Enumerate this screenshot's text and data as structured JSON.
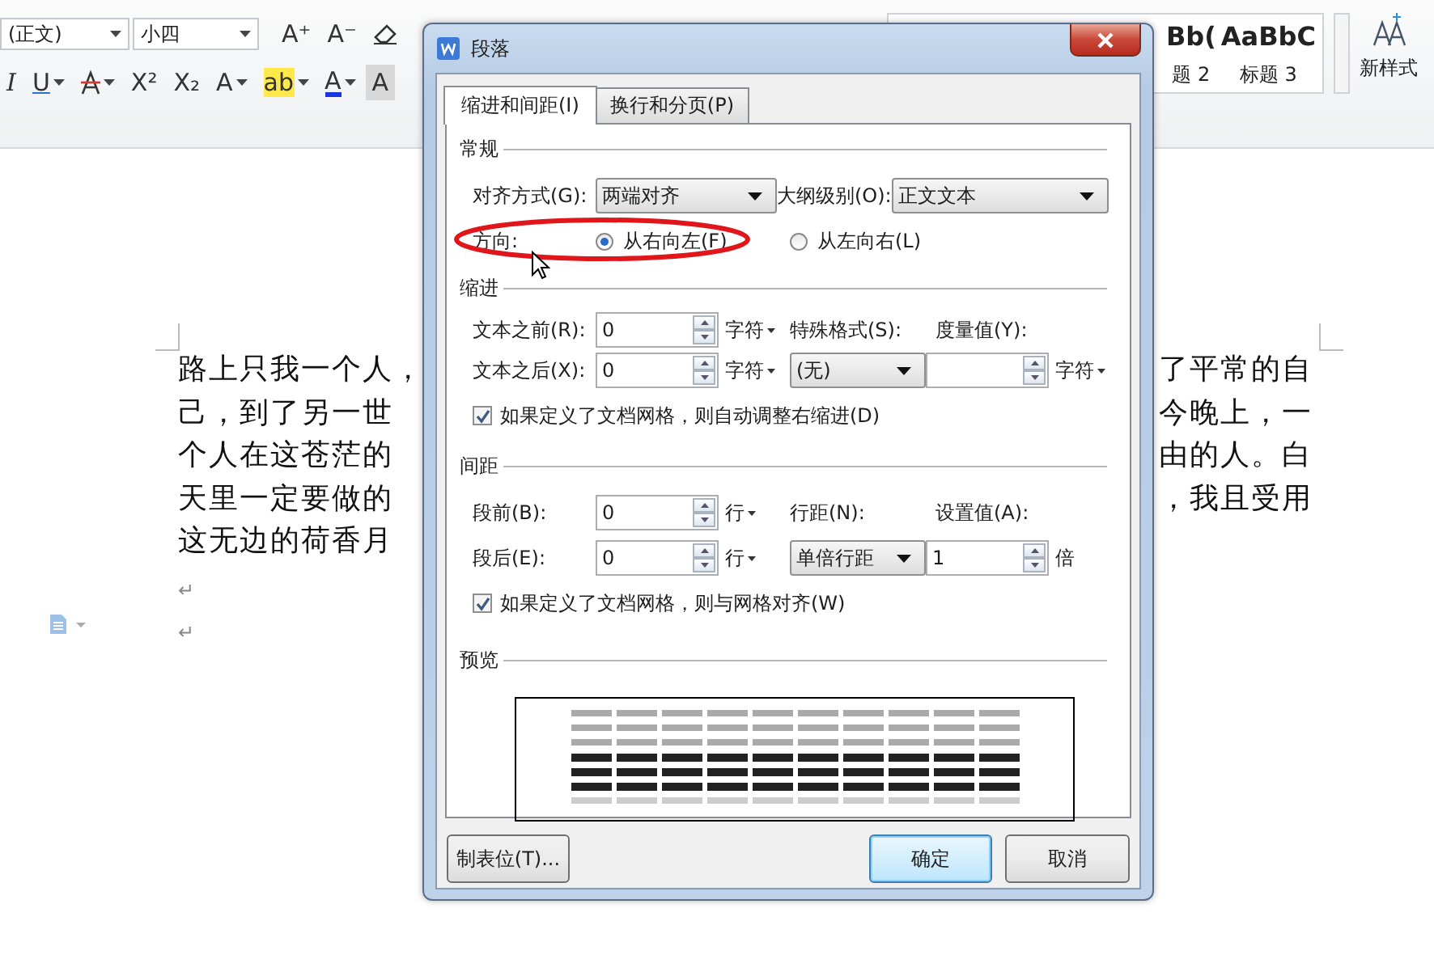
{
  "ribbon": {
    "font_name": "(正文)",
    "font_size": "小四",
    "row_1": [
      {
        "kind": "grow",
        "glyph": "A⁺",
        "menu": false
      },
      {
        "kind": "shrink",
        "glyph": "A⁻",
        "menu": false
      },
      {
        "kind": "eraser",
        "menu": false
      }
    ],
    "row_2": [
      {
        "kind": "italic",
        "glyph": "I",
        "menu": false
      },
      {
        "kind": "underline",
        "glyph": "U",
        "menu": true
      },
      {
        "kind": "strike",
        "menu": true
      },
      {
        "kind": "superscript",
        "glyph": "X²",
        "menu": false
      },
      {
        "kind": "subscript",
        "glyph": "X₂",
        "menu": false
      },
      {
        "kind": "outline",
        "glyph": "A",
        "menu": true
      },
      {
        "kind": "highlight",
        "glyph": "ab",
        "menu": true
      },
      {
        "kind": "color",
        "glyph": "A",
        "menu": true
      },
      {
        "kind": "shade",
        "glyph": "A",
        "menu": false
      }
    ],
    "styles": [
      {
        "preview": "Bb(",
        "label": "题 2"
      },
      {
        "preview": "AaBbC",
        "label": "标题 3"
      }
    ],
    "new_style": "新样式"
  },
  "document": {
    "lines": [
      {
        "left": "路上只我一个人，",
        "right": "了平常的自"
      },
      {
        "left": "己，到了另一世",
        "right": "今晚上，一"
      },
      {
        "left": "个人在这苍茫的",
        "right": "由的人。白"
      },
      {
        "left": "天里一定要做的",
        "right": "，我且受用"
      },
      {
        "left": "这无边的荷香月"
      }
    ],
    "marks": [
      "↵",
      "↵"
    ]
  },
  "dialog": {
    "title": "段落",
    "tabs": [
      {
        "label": "缩进和间距(I)",
        "selected": true
      },
      {
        "label": "换行和分页(P)",
        "selected": false
      }
    ],
    "general": {
      "heading": "常规",
      "alignment": {
        "label": "对齐方式(G):",
        "value": "两端对齐"
      },
      "outline": {
        "label": "大纲级别(O):",
        "value": "正文文本"
      },
      "direction": {
        "label": "方向:",
        "options": [
          {
            "label": "从右向左(F)",
            "selected": true
          },
          {
            "label": "从左向右(L)",
            "selected": false
          }
        ]
      }
    },
    "indent": {
      "heading": "缩进",
      "before": {
        "label": "文本之前(R):",
        "value": "0",
        "unit": "字符"
      },
      "special": {
        "label": "特殊格式(S):",
        "value": "(无)"
      },
      "measure": {
        "label": "度量值(Y):",
        "unit": "字符"
      },
      "after": {
        "label": "文本之后(X):",
        "value": "0",
        "unit": "字符"
      },
      "auto_adjust": {
        "label": "如果定义了文档网格，则自动调整右缩进(D)",
        "checked": true
      }
    },
    "spacing": {
      "heading": "间距",
      "before": {
        "label": "段前(B):",
        "value": "0",
        "unit": "行"
      },
      "line_spacing": {
        "label": "行距(N):",
        "value": "单倍行距"
      },
      "set_value": {
        "label": "设置值(A):",
        "value": "1",
        "unit": "倍"
      },
      "after": {
        "label": "段后(E):",
        "value": "0",
        "unit": "行"
      },
      "snap_grid": {
        "label": "如果定义了文档网格，则与网格对齐(W)",
        "checked": true
      }
    },
    "preview": {
      "heading": "预览"
    },
    "buttons": {
      "tabs": "制表位(T)...",
      "ok": "确定",
      "cancel": "取消"
    }
  }
}
